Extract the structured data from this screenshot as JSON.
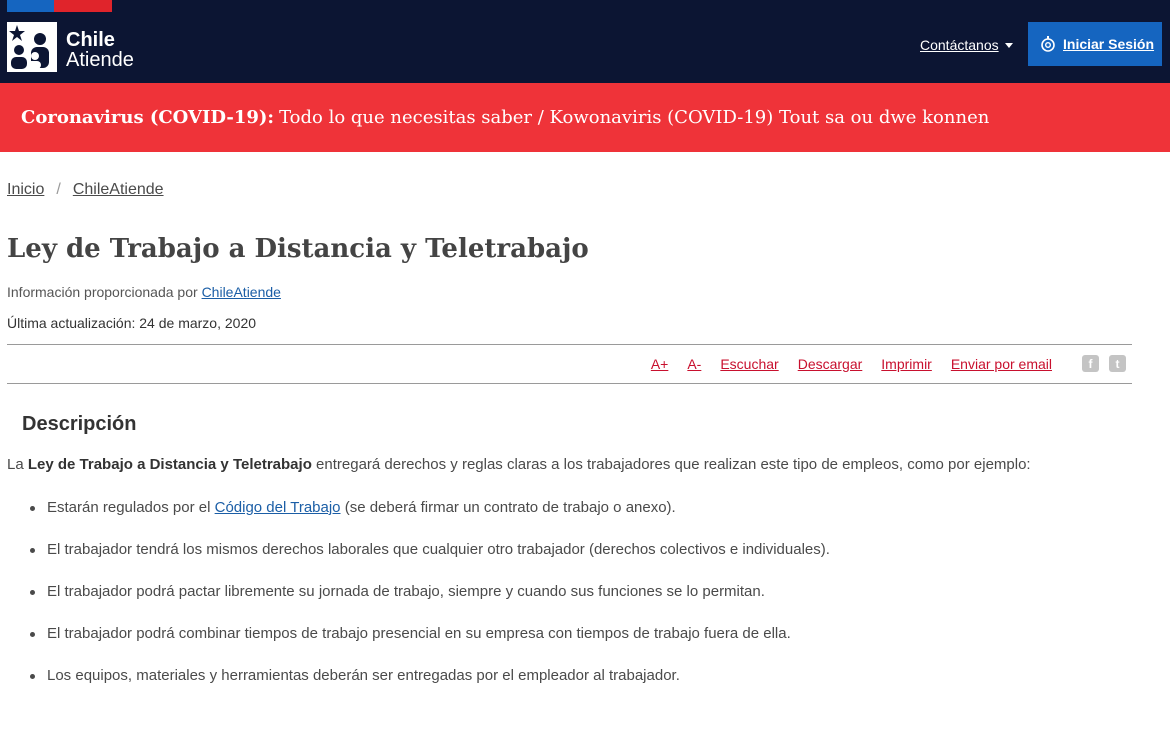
{
  "header": {
    "logo_line1": "Chile",
    "logo_line2": "Atiende",
    "contact_label": "Contáctanos",
    "login_label": "Iniciar Sesión"
  },
  "alert": {
    "bold": "Coronavirus (COVID-19):",
    "text": "Todo lo que necesitas saber / Kowonaviris (COVID-19) Tout sa ou dwe konnen"
  },
  "breadcrumb": {
    "items": [
      "Inicio",
      "ChileAtiende"
    ],
    "separator": "/"
  },
  "article": {
    "title": "Ley de Trabajo a Distancia y Teletrabajo",
    "provided_prefix": "Información proporcionada por",
    "provided_link": "ChileAtiende",
    "updated": "Última actualización: 24 de marzo, 2020"
  },
  "toolbar": {
    "font_up": "A+",
    "font_down": "A-",
    "listen": "Escuchar",
    "download": "Descargar",
    "print": "Imprimir",
    "email": "Enviar por email",
    "facebook_glyph": "f",
    "twitter_glyph": "t"
  },
  "description": {
    "heading": "Descripción",
    "intro_prefix": "La",
    "intro_bold": "Ley de Trabajo a Distancia y Teletrabajo",
    "intro_rest": "entregará derechos y reglas claras a los trabajadores que realizan este tipo de empleos, como por ejemplo:",
    "item1_prefix": "Estarán regulados por el",
    "item1_link": "Código del Trabajo",
    "item1_rest": "(se deberá firmar un contrato de trabajo o anexo).",
    "items": [
      "El trabajador tendrá los mismos derechos laborales que cualquier otro trabajador (derechos colectivos e individuales).",
      "El trabajador podrá pactar libremente su jornada de trabajo, siempre y cuando sus funciones se lo permitan.",
      "El trabajador podrá combinar tiempos de trabajo presencial en su empresa con tiempos de trabajo fuera de ella.",
      "Los equipos, materiales y herramientas deberán ser entregadas por el empleador al trabajador."
    ]
  },
  "colors": {
    "header_bg": "#0c1533",
    "alert_bg": "#ef3339",
    "primary_blue": "#1565c0",
    "tool_red": "#c8102e"
  }
}
